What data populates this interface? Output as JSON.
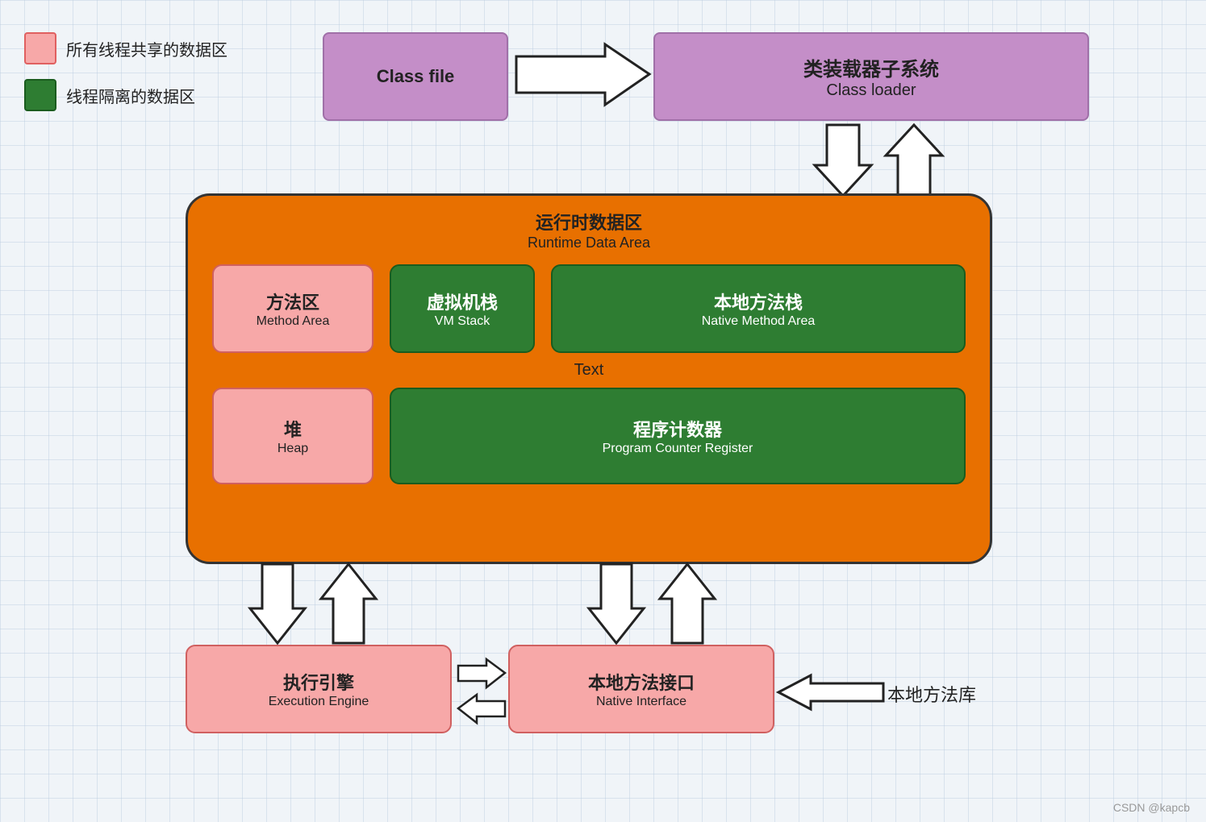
{
  "legend": {
    "shared_label": "所有线程共享的数据区",
    "isolated_label": "线程隔离的数据区"
  },
  "class_file": {
    "label": "Class file"
  },
  "class_loader": {
    "zh": "类装载器子系统",
    "en": "Class loader"
  },
  "runtime": {
    "zh": "运行时数据区",
    "en": "Runtime Data Area",
    "method_area": {
      "zh": "方法区",
      "en": "Method Area"
    },
    "vm_stack": {
      "zh": "虚拟机栈",
      "en": "VM Stack"
    },
    "native_method_area": {
      "zh": "本地方法栈",
      "en": "Native Method Area"
    },
    "text_label": "Text",
    "heap": {
      "zh": "堆",
      "en": "Heap"
    },
    "program_counter": {
      "zh": "程序计数器",
      "en": "Program Counter Register"
    }
  },
  "execution_engine": {
    "zh": "执行引擎",
    "en": "Execution Engine"
  },
  "native_interface": {
    "zh": "本地方法接口",
    "en": "Native Interface"
  },
  "native_library": {
    "label": "本地方法库"
  },
  "watermark": "CSDN @kapcb"
}
